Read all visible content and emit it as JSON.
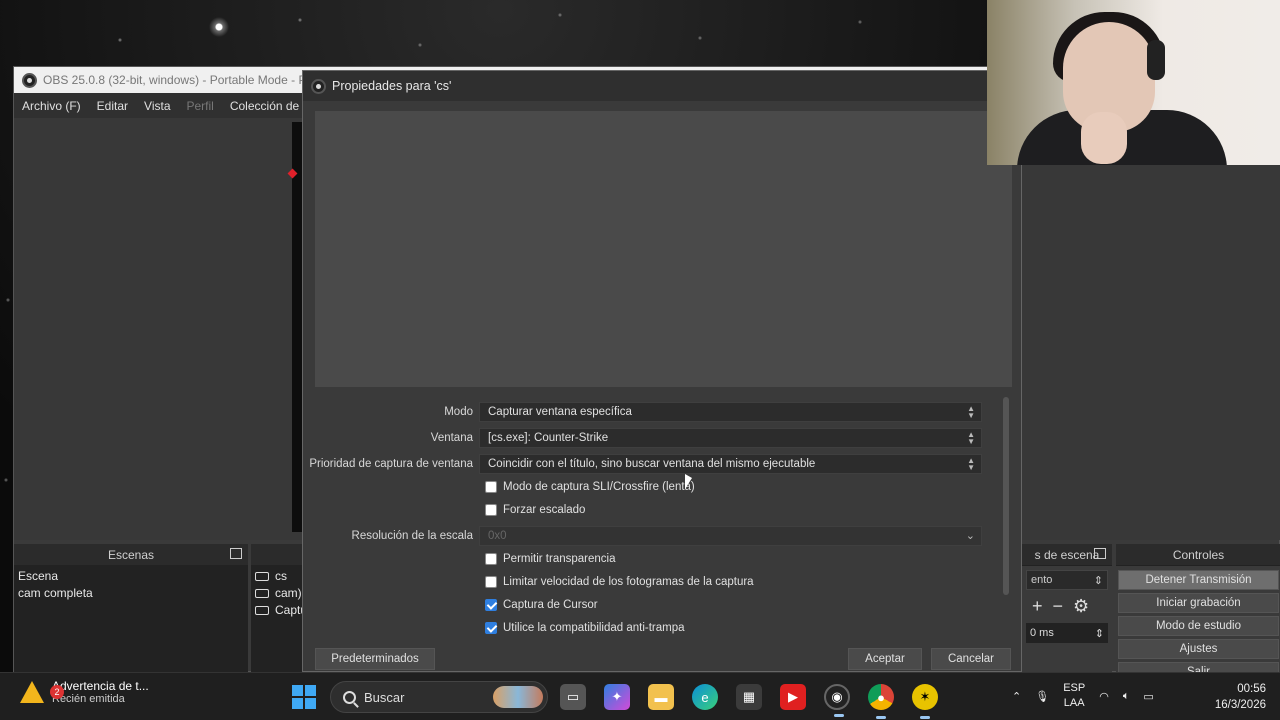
{
  "obs": {
    "title": "OBS 25.0.8 (32-bit, windows) - Portable Mode - P",
    "menu": [
      "Archivo (F)",
      "Editar",
      "Vista",
      "Perfil",
      "Colección de E"
    ],
    "scenes_header": "Escenas",
    "scenes": [
      "Escena",
      "cam completa"
    ],
    "sources": [
      "cs",
      "cam)",
      "Captu"
    ],
    "transitions_header": "s de escena",
    "transition_select": "ento",
    "transition_duration": "0 ms",
    "controls_header": "Controles",
    "controls": [
      "Detener Transmisión",
      "Iniciar grabación",
      "Modo de estudio",
      "Ajustes",
      "Salir"
    ]
  },
  "dialog": {
    "title": "Propiedades para 'cs'",
    "fields": {
      "mode_label": "Modo",
      "mode_value": "Capturar ventana específica",
      "window_label": "Ventana",
      "window_value": "[cs.exe]: Counter-Strike",
      "priority_label": "Prioridad de captura de ventana",
      "priority_value": "Coincidir con el título, sino buscar ventana del mismo ejecutable",
      "scale_label": "Resolución de la escala",
      "scale_value": "0x0"
    },
    "checkboxes": [
      {
        "label": "Modo de captura SLI/Crossfire (lenta)",
        "checked": false
      },
      {
        "label": "Forzar escalado",
        "checked": false
      },
      {
        "label": "Permitir transparencia",
        "checked": false
      },
      {
        "label": "Limitar velocidad de los fotogramas de la captura",
        "checked": false
      },
      {
        "label": "Captura de Cursor",
        "checked": true
      },
      {
        "label": "Utilice la compatibilidad anti-trampa",
        "checked": true
      }
    ],
    "defaults_button": "Predeterminados",
    "ok_button": "Aceptar",
    "cancel_button": "Cancelar"
  },
  "taskbar": {
    "notification_title": "Advertencia de t...",
    "notification_sub": "Recién emitida",
    "notification_badge": "2",
    "search_placeholder": "Buscar",
    "lang_top": "ESP",
    "lang_bottom": "LAA",
    "time": "00:56",
    "date": "16/3/2026"
  },
  "colors": {
    "accent": "#2f7fe0",
    "dialog_bg": "#3a3a3a",
    "taskbar_bg": "#1f1f1f"
  }
}
